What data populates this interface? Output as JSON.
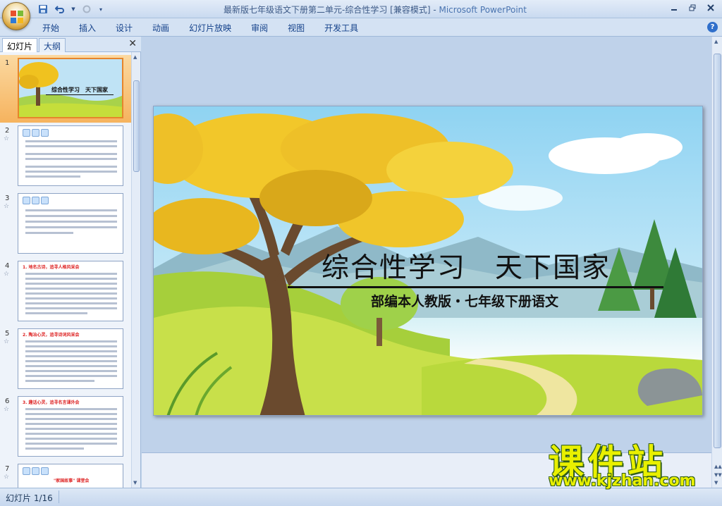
{
  "window": {
    "title": "最新版七年级语文下册第二单元-综合性学习 [兼容模式] - ",
    "app_name": "Microsoft PowerPoint"
  },
  "ribbon": {
    "tabs": [
      "开始",
      "插入",
      "设计",
      "动画",
      "幻灯片放映",
      "审阅",
      "视图",
      "开发工具"
    ]
  },
  "left_pane": {
    "tabs": [
      "幻灯片",
      "大纲"
    ],
    "close_glyph": "✕",
    "slides": [
      {
        "num": "1",
        "title": "综合性学习　天下国家"
      },
      {
        "num": "2",
        "title": ""
      },
      {
        "num": "3",
        "title": ""
      },
      {
        "num": "4",
        "title": "1. 地名古诗，追寻人格风采会"
      },
      {
        "num": "5",
        "title": "2. 陶冶心灵，追寻诗词风采会"
      },
      {
        "num": "6",
        "title": "3. 趣话心灵，追寻名言课外会"
      },
      {
        "num": "7",
        "title": "\"家国故事\" 课堂会"
      }
    ]
  },
  "slide": {
    "title": "综合性学习　天下国家",
    "subtitle": "部编本人教版・七年级下册语文"
  },
  "status": {
    "slide_counter": "幻灯片 1/16"
  },
  "watermark": {
    "title": "课件站",
    "url": "www.kjzhan.com"
  },
  "icons": {
    "office": "office-button-icon",
    "save": "save-icon",
    "undo": "undo-icon",
    "redo": "redo-icon",
    "help": "help-icon"
  }
}
